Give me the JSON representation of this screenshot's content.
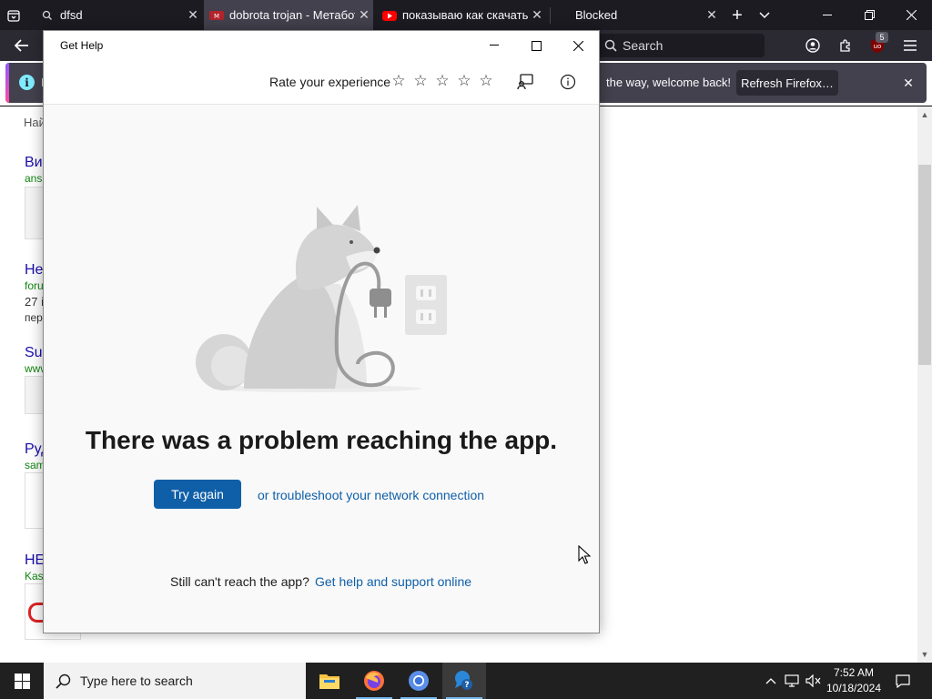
{
  "firefox": {
    "tabs": [
      {
        "title": "dfsd",
        "favicon": "search-icon",
        "active": false
      },
      {
        "title": "dobrota trojan - Метабот",
        "favicon": "metabot-icon",
        "active": true
      },
      {
        "title": "показываю как скачать",
        "favicon": "youtube-icon",
        "active": false
      },
      {
        "title": "Blocked",
        "favicon": "none",
        "active": false
      }
    ],
    "search_placeholder": "Search",
    "extension_badge": "5",
    "notification": {
      "prefix": "I",
      "text": "the way, welcome back!",
      "button": "Refresh Firefox…"
    }
  },
  "page": {
    "results": [
      {
        "top_text": "Най"
      },
      {
        "title": "Ви",
        "url": "ans"
      },
      {
        "title": "Не",
        "url": "foru",
        "line1": "27 і",
        "line2": "пер"
      },
      {
        "title": "Su",
        "url": "www"
      },
      {
        "title": "Руд",
        "url": "sam"
      },
      {
        "title": "НЕ",
        "url": "Kas"
      }
    ]
  },
  "get_help": {
    "window_title": "Get Help",
    "rate_label": "Rate your experience",
    "rating": 0,
    "rating_max": 5,
    "error_title": "There was a problem reaching the app.",
    "try_again": "Try again",
    "troubleshoot_link": "or troubleshoot your network connection",
    "still_text": "Still can't reach the app?",
    "support_link": "Get help and support online"
  },
  "taskbar": {
    "search_placeholder": "Type here to search",
    "apps": [
      "file-explorer",
      "firefox",
      "chromium",
      "get-help"
    ],
    "time": "7:52 AM",
    "date": "10/18/2024"
  },
  "colors": {
    "ff_tabbar": "#1c1b22",
    "ff_navbar": "#2b2a33",
    "gh_accent": "#0f5fa8",
    "taskbar": "#202020"
  }
}
